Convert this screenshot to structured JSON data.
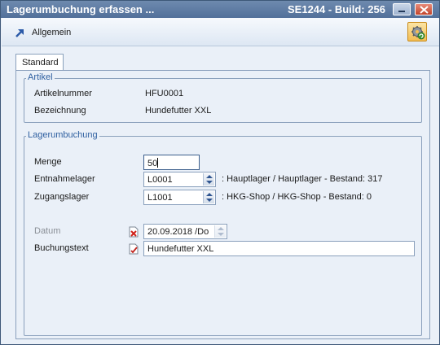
{
  "window": {
    "title": "Lagerumbuchung erfassen ...",
    "build": "SE1244 - Build: 256"
  },
  "toolbar": {
    "general_label": "Allgemein",
    "settings_icon": "gear-refresh-icon"
  },
  "tab": {
    "label": "Standard"
  },
  "artikel": {
    "legend": "Artikel",
    "artikelnummer_label": "Artikelnummer",
    "artikelnummer_value": "HFU0001",
    "bezeichnung_label": "Bezeichnung",
    "bezeichnung_value": "Hundefutter XXL"
  },
  "lagerumbuchung": {
    "legend": "Lagerumbuchung",
    "menge_label": "Menge",
    "menge_value": "50",
    "entnahmelager_label": "Entnahmelager",
    "entnahmelager_value": "L0001",
    "entnahmelager_info": ": Hauptlager / Hauptlager - Bestand: 317",
    "zugangslager_label": "Zugangslager",
    "zugangslager_value": "L1001",
    "zugangslager_info": ": HKG-Shop / HKG-Shop - Bestand: 0",
    "datum_label": "Datum",
    "datum_value": "20.09.2018 /Do",
    "buchungstext_label": "Buchungstext",
    "buchungstext_value": "Hundefutter XXL"
  },
  "colors": {
    "titlebar": "#52709a",
    "legend_text": "#2e5fa0",
    "background": "#eaf0f8"
  }
}
